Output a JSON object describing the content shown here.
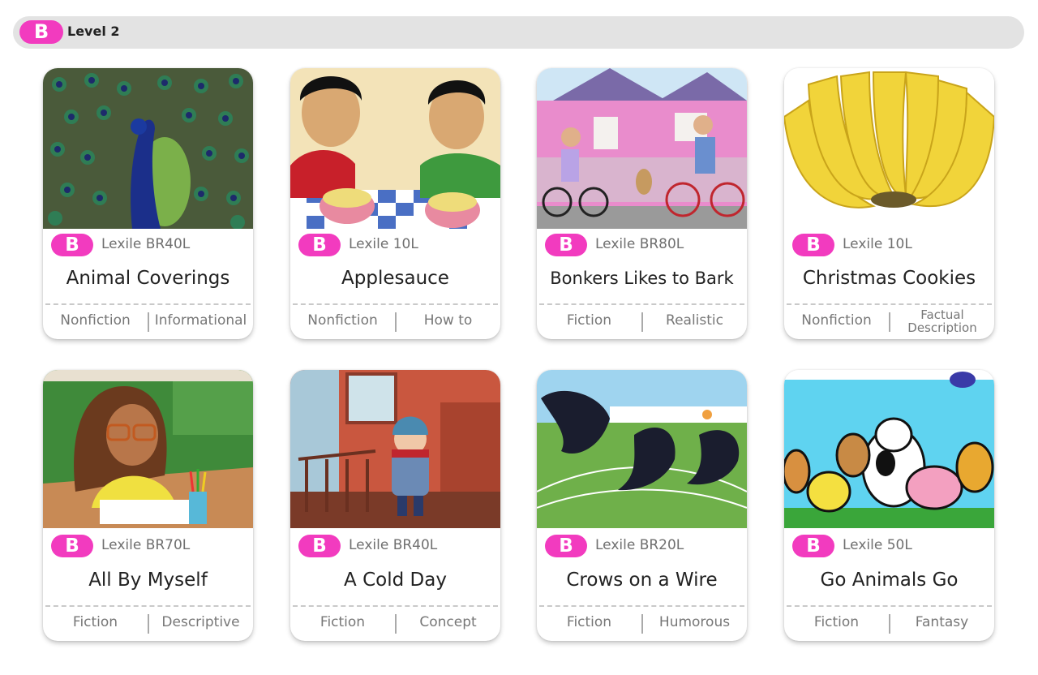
{
  "level": {
    "badge": "B",
    "label": "Level 2"
  },
  "accent_color": "#f23bbf",
  "books": [
    {
      "badge": "B",
      "lexile": "Lexile BR40L",
      "title": "Animal Coverings",
      "tags": [
        "Nonfiction",
        "Informational"
      ],
      "cover": "peacock-cover"
    },
    {
      "badge": "B",
      "lexile": "Lexile 10L",
      "title": "Applesauce",
      "tags": [
        "Nonfiction",
        "How to"
      ],
      "cover": "kids-eating-applesauce-cover"
    },
    {
      "badge": "B",
      "lexile": "Lexile BR80L",
      "title": "Bonkers Likes to Bark",
      "tags": [
        "Fiction",
        "Realistic"
      ],
      "cover": "kids-on-bikes-cover"
    },
    {
      "badge": "B",
      "lexile": "Lexile 10L",
      "title": "Christmas Cookies",
      "tags": [
        "Nonfiction",
        "Factual Description"
      ],
      "cover": "bananas-cover"
    },
    {
      "badge": "B",
      "lexile": "Lexile BR70L",
      "title": "All By Myself",
      "tags": [
        "Fiction",
        "Descriptive"
      ],
      "cover": "girl-drawing-cover"
    },
    {
      "badge": "B",
      "lexile": "Lexile BR40L",
      "title": "A Cold Day",
      "tags": [
        "Fiction",
        "Concept"
      ],
      "cover": "boy-in-snow-cover"
    },
    {
      "badge": "B",
      "lexile": "Lexile BR20L",
      "title": "Crows on a Wire",
      "tags": [
        "Fiction",
        "Humorous"
      ],
      "cover": "crows-on-wire-cover"
    },
    {
      "badge": "B",
      "lexile": "Lexile 50L",
      "title": "Go Animals Go",
      "tags": [
        "Fiction",
        "Fantasy"
      ],
      "cover": "farm-animals-cover"
    }
  ]
}
